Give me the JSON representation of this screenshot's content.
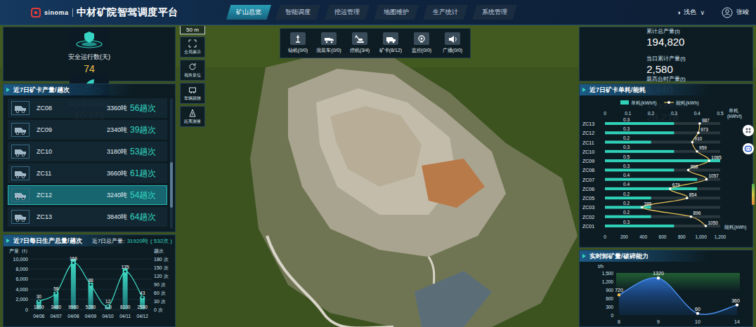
{
  "header": {
    "brand": "sinoma",
    "title": "中材矿院智驾调度平台",
    "tabs": [
      {
        "label": "矿山总览",
        "selected": true
      },
      {
        "label": "智能调度",
        "selected": false
      },
      {
        "label": "挖运管理",
        "selected": false
      },
      {
        "label": "地图维护",
        "selected": false
      },
      {
        "label": "生产统计",
        "selected": false
      },
      {
        "label": "系统管理",
        "selected": false
      }
    ],
    "theme_icon": "◑",
    "theme": "浅色",
    "theme_arrow": "∨",
    "user": "张峻"
  },
  "map": {
    "scale": "50 m",
    "tools": [
      {
        "label": "全局展示"
      },
      {
        "label": "视角复位"
      },
      {
        "label": "车辆跟随"
      },
      {
        "label": "距离测量"
      }
    ],
    "equipment": [
      {
        "label": "钻机(0/0)",
        "kind": "drill"
      },
      {
        "label": "混装车(0/0)",
        "kind": "mixer"
      },
      {
        "label": "挖机(3/4)",
        "kind": "excavator"
      },
      {
        "label": "矿卡(8/12)",
        "kind": "truck"
      },
      {
        "label": "监控(0/0)",
        "kind": "camera"
      },
      {
        "label": "广播(0/0)",
        "kind": "speaker"
      }
    ]
  },
  "left": {
    "stats": [
      {
        "label": "安全运行数(天)",
        "value": "74"
      },
      {
        "label": "减少碳排放(kg)",
        "value": "10,373"
      }
    ],
    "truck_list": {
      "title": "近7日矿卡产量/趟次",
      "rows": [
        {
          "name": "ZC08",
          "tons": "3360吨",
          "trips": "56趟次",
          "selected": false
        },
        {
          "name": "ZC09",
          "tons": "2340吨",
          "trips": "39趟次",
          "selected": false
        },
        {
          "name": "ZC10",
          "tons": "3180吨",
          "trips": "53趟次",
          "selected": false
        },
        {
          "name": "ZC11",
          "tons": "3660吨",
          "trips": "61趟次",
          "selected": false
        },
        {
          "name": "ZC12",
          "tons": "3240吨",
          "trips": "54趟次",
          "selected": true
        },
        {
          "name": "ZC13",
          "tons": "3840吨",
          "trips": "64趟次",
          "selected": false
        }
      ],
      "scroll": {
        "level": 0.75
      }
    },
    "daily_chart": {
      "title": "近7日每日生产总量/趟次",
      "total_label": "近7日总产量:",
      "total_value": "31920吨",
      "total_count": "( 532次 )",
      "left_title": "产量（t）",
      "right_title": "趟次",
      "left_ticks": [
        "10,000",
        "8,000",
        "6,000",
        "4,000",
        "2,000",
        "0"
      ],
      "right_ticks": [
        "180 次",
        "150 次",
        "120 次",
        "90 次",
        "60 次",
        "30 次",
        "0 次"
      ],
      "dates": [
        "04/06",
        "04/07",
        "04/08",
        "04/09",
        "04/10",
        "04/11",
        "04/12"
      ],
      "production": [
        1800,
        3480,
        9960,
        5280,
        720,
        8100,
        2580
      ],
      "production_labels": [
        "1800",
        "3480",
        "9960",
        "5280",
        "720",
        "8100",
        "2580"
      ],
      "trips": [
        30,
        58,
        166,
        88,
        12,
        135,
        43
      ],
      "trip_labels": [
        "30",
        "58",
        "166",
        "88",
        "12",
        "135",
        "43"
      ]
    }
  },
  "right": {
    "stats": [
      {
        "label": "累计总产量(t)",
        "value": "194,820"
      },
      {
        "label": "当日累计产量(t)",
        "value": "2,580"
      },
      {
        "label": "最高台时产量(t)",
        "value": "1,440"
      },
      {
        "label": "累计里程数(km)",
        "value": "28,218"
      }
    ],
    "energy_chart": {
      "title": "近7日矿卡单耗/能耗",
      "legend_unit": "单耗(kWh/t)",
      "legend_energy": "能耗(kWh)",
      "top_ticks": [
        "0",
        "0.1",
        "0.2",
        "0.3",
        "0.4",
        "0.5"
      ],
      "top_title": "单耗",
      "top_title_unit": "(kWh/t)",
      "bottom_ticks": [
        "0",
        "200",
        "400",
        "600",
        "800",
        "1,000",
        "1,200"
      ],
      "bottom_title": "能耗(kWh)",
      "rows": [
        {
          "name": "ZC13",
          "unit_value": 0.3,
          "unit_label": "0.3",
          "energy": 987,
          "energy_label": "987"
        },
        {
          "name": "ZC12",
          "unit_value": 0.3,
          "unit_label": "0.3",
          "energy": 973,
          "energy_label": "973"
        },
        {
          "name": "ZC11",
          "unit_value": 0.2,
          "unit_label": "0.2",
          "energy": 910,
          "energy_label": "910"
        },
        {
          "name": "ZC10",
          "unit_value": 0.3,
          "unit_label": "0.3",
          "energy": 959,
          "energy_label": "959"
        },
        {
          "name": "ZC09",
          "unit_value": 0.5,
          "unit_label": "0.5",
          "energy": 1085,
          "energy_label": "1085"
        },
        {
          "name": "ZC08",
          "unit_value": 0.3,
          "unit_label": "0.3",
          "energy": 868,
          "energy_label": "868"
        },
        {
          "name": "ZC07",
          "unit_value": 0.4,
          "unit_label": "0.4",
          "energy": 1057,
          "energy_label": "1057"
        },
        {
          "name": "ZC06",
          "unit_value": 0.4,
          "unit_label": "0.4",
          "energy": 679,
          "energy_label": "679"
        },
        {
          "name": "ZC05",
          "unit_value": 0.2,
          "unit_label": "0.2",
          "energy": 854,
          "energy_label": "854"
        },
        {
          "name": "ZC03",
          "unit_value": 0.2,
          "unit_label": "0.2",
          "energy": 385,
          "energy_label": "385"
        },
        {
          "name": "ZC02",
          "unit_value": 0.2,
          "unit_label": "0.2",
          "energy": 896,
          "energy_label": "896"
        },
        {
          "name": "ZC01",
          "unit_value": 0.3,
          "unit_label": "0.3",
          "energy": 1050,
          "energy_label": "1050"
        }
      ]
    },
    "unload_chart": {
      "title": "实时卸矿量/破碎能力",
      "unit": "t/h",
      "ticks": [
        "1,500",
        "1,200",
        "900",
        "600",
        "300",
        "0"
      ],
      "x_labels": [
        "8",
        "9",
        "10",
        "14"
      ],
      "values": [
        720,
        1320,
        60,
        360
      ],
      "value_labels": [
        "720",
        "1320",
        "60",
        "360"
      ]
    }
  }
}
